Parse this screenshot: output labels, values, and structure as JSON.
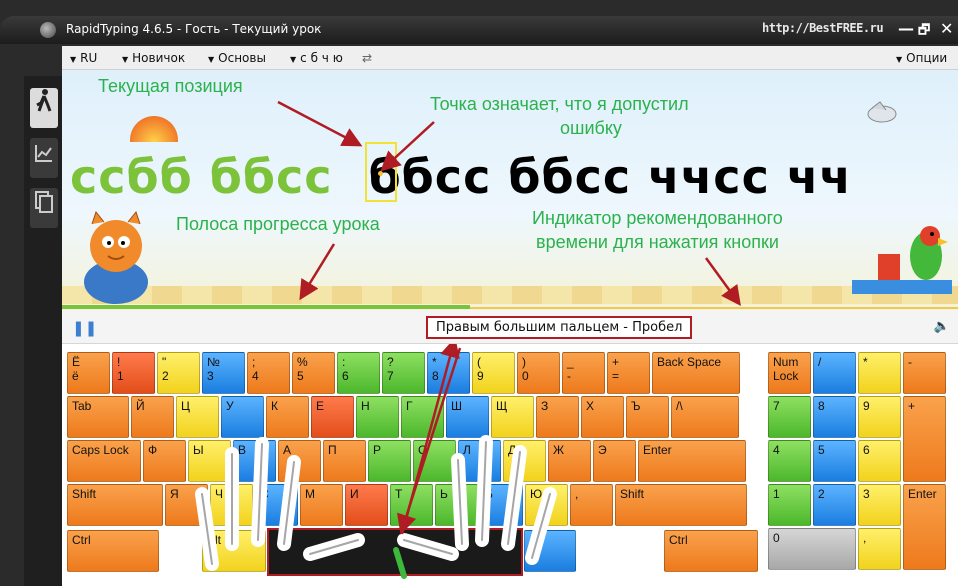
{
  "window": {
    "title": "RapidTyping 4.6.5 - Гость - Текущий урок",
    "site": "http://BestFREE.ru",
    "minimize": "—",
    "restore": "🗗",
    "close": "✕"
  },
  "menu": {
    "items": [
      {
        "label": "RU"
      },
      {
        "label": "Новичок"
      },
      {
        "label": "Основы"
      },
      {
        "label": "с б ч ю"
      }
    ],
    "refresh_icon": "⇄",
    "options": "Опции"
  },
  "sidebar": {
    "items": [
      {
        "icon": "runner-icon",
        "glyph": "🏃",
        "active": true
      },
      {
        "icon": "chart-icon",
        "glyph": "📈",
        "active": false
      },
      {
        "icon": "document-icon",
        "glyph": "📄",
        "active": false
      }
    ]
  },
  "lesson": {
    "typed": "ссбб  ббсс",
    "remaining": "ббсс  ббсс  ччсс  чч",
    "progress_fraction": 0.455
  },
  "annotations": {
    "current_position": "Текущая позиция",
    "error_dot_line1": "Точка означает, что я допустил",
    "error_dot_line2": "ошибку",
    "progress_bar": "Полоса прогресса урока",
    "timing_line1": "Индикатор рекомендованного",
    "timing_line2": "времени для нажатия кнопки",
    "color": "#2bb24c",
    "arrow_color": "#b01c24"
  },
  "status": {
    "hint": "Правым большим пальцем - Пробел",
    "pause_icon": "pause-icon",
    "sound_icon": "speaker-icon"
  },
  "keyboard": {
    "row1": [
      {
        "a": "Ё",
        "b": "ё",
        "c": "o"
      },
      {
        "a": "!",
        "b": "1",
        "c": "r"
      },
      {
        "a": "\"",
        "b": "2",
        "c": "y"
      },
      {
        "a": "№",
        "b": "3",
        "c": "b"
      },
      {
        "a": ";",
        "b": "4",
        "c": "o"
      },
      {
        "a": "%",
        "b": "5",
        "c": "o"
      },
      {
        "a": ":",
        "b": "6",
        "c": "g"
      },
      {
        "a": "?",
        "b": "7",
        "c": "g"
      },
      {
        "a": "*",
        "b": "8",
        "c": "b"
      },
      {
        "a": "(",
        "b": "9",
        "c": "y"
      },
      {
        "a": ")",
        "b": "0",
        "c": "o"
      },
      {
        "a": "_",
        "b": "-",
        "c": "o"
      },
      {
        "a": "+",
        "b": "=",
        "c": "o"
      },
      {
        "a": "Back Space",
        "b": "",
        "c": "o"
      }
    ],
    "row2": [
      "Tab",
      "Й",
      "Ц",
      "У",
      "К",
      "Е",
      "Н",
      "Г",
      "Ш",
      "Щ",
      "З",
      "Х",
      "Ъ",
      "/\\"
    ],
    "row3": [
      "Caps Lock",
      "Ф",
      "Ы",
      "В",
      "А",
      "П",
      "Р",
      "О",
      "Л",
      "Д",
      "Ж",
      "Э",
      "Enter"
    ],
    "row4": [
      "Shift",
      "Я",
      "Ч",
      "С",
      "М",
      "И",
      "Т",
      "Ь",
      "Б",
      "Ю",
      ",",
      "Shift"
    ],
    "row5": [
      "Ctrl",
      "Alt",
      "Alt",
      "Ctrl"
    ],
    "numpad": [
      "Num Lock",
      "/",
      "*",
      "-",
      "7",
      "8",
      "9",
      "+",
      "4",
      "5",
      "6",
      "1",
      "2",
      "3",
      "Enter",
      "0",
      ","
    ]
  }
}
